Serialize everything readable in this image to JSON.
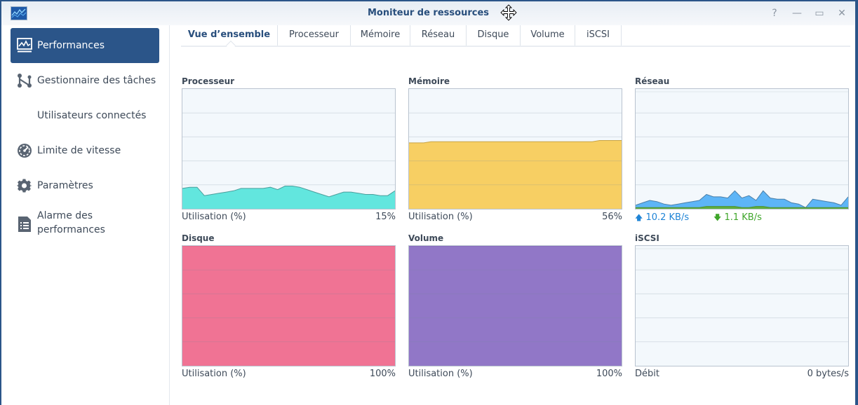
{
  "window": {
    "title": "Moniteur de ressources",
    "controls": [
      {
        "name": "help",
        "glyph": "?"
      },
      {
        "name": "minimize",
        "glyph": "—"
      },
      {
        "name": "maximize",
        "glyph": "▭"
      },
      {
        "name": "close",
        "glyph": "✕"
      }
    ]
  },
  "sidebar": {
    "items": [
      {
        "label": "Performances",
        "icon": "performance-chart-icon",
        "active": true
      },
      {
        "label": "Gestionnaire des tâches",
        "icon": "task-manager-icon",
        "active": false
      },
      {
        "label": "Utilisateurs connectés",
        "icon": "",
        "active": false
      },
      {
        "label": "Limite de vitesse",
        "icon": "speedometer-icon",
        "active": false
      },
      {
        "label": "Paramètres",
        "icon": "gear-icon",
        "active": false
      },
      {
        "label": "Alarme des performances",
        "icon": "document-list-icon",
        "active": false
      }
    ]
  },
  "tabs": [
    {
      "label": "Vue d’ensemble",
      "active": true
    },
    {
      "label": "Processeur",
      "active": false
    },
    {
      "label": "Mémoire",
      "active": false
    },
    {
      "label": "Réseau",
      "active": false
    },
    {
      "label": "Disque",
      "active": false
    },
    {
      "label": "Volume",
      "active": false
    },
    {
      "label": "iSCSI",
      "active": false
    }
  ],
  "colors": {
    "accent": "#2b5589",
    "cpu": "#62e6de",
    "memory": "#f7cf63",
    "network_up": "#5db5f7",
    "network_down": "#5fae3e",
    "disk": "#f07394",
    "volume": "#9177c7"
  },
  "chart_data": [
    {
      "id": "cpu",
      "type": "area",
      "title": "Processeur",
      "footer_label": "Utilisation (%)",
      "footer_value": "15%",
      "ylim": [
        0,
        100
      ],
      "grid": true,
      "series": [
        {
          "name": "cpu",
          "values": [
            17,
            18,
            18,
            11,
            12,
            13,
            14,
            15,
            17,
            17,
            17,
            17,
            18,
            16,
            19,
            19,
            18,
            16,
            14,
            12,
            10,
            12,
            14,
            14,
            13,
            12,
            12,
            11,
            11,
            15
          ]
        }
      ]
    },
    {
      "id": "memory",
      "type": "area",
      "title": "Mémoire",
      "footer_label": "Utilisation (%)",
      "footer_value": "56%",
      "ylim": [
        0,
        100
      ],
      "grid": true,
      "series": [
        {
          "name": "memory",
          "values": [
            55,
            55,
            55,
            56,
            56,
            56,
            56,
            56,
            56,
            56,
            56,
            56,
            56,
            56,
            56,
            56,
            56,
            56,
            56,
            56,
            56,
            56,
            56,
            56,
            56,
            56,
            57,
            57,
            57,
            57
          ]
        }
      ]
    },
    {
      "id": "network",
      "type": "area",
      "title": "Réseau",
      "footer_up": "10.2 KB/s",
      "footer_down": "1.1 KB/s",
      "ylim": [
        0,
        100
      ],
      "grid": true,
      "series": [
        {
          "name": "upload",
          "values": [
            3,
            5,
            7,
            6,
            4,
            3,
            4,
            5,
            6,
            7,
            12,
            10,
            10,
            9,
            15,
            9,
            11,
            7,
            15,
            9,
            8,
            8,
            5,
            4,
            1,
            8,
            7,
            6,
            5,
            3,
            10
          ]
        },
        {
          "name": "download",
          "values": [
            1,
            1,
            1,
            1,
            1,
            1,
            1,
            1,
            1,
            1,
            2,
            2,
            2,
            2,
            2,
            1,
            1,
            2,
            2,
            1,
            1,
            1,
            1,
            1,
            1,
            1,
            1,
            1,
            1,
            1,
            1
          ]
        }
      ]
    },
    {
      "id": "disk",
      "type": "area",
      "title": "Disque",
      "footer_label": "Utilisation (%)",
      "footer_value": "100%",
      "ylim": [
        0,
        100
      ],
      "grid": true,
      "series": [
        {
          "name": "disk",
          "values": [
            100,
            100,
            100,
            100,
            100,
            100,
            100,
            100,
            100,
            100
          ]
        }
      ]
    },
    {
      "id": "volume",
      "type": "area",
      "title": "Volume",
      "footer_label": "Utilisation (%)",
      "footer_value": "100%",
      "ylim": [
        0,
        100
      ],
      "grid": true,
      "series": [
        {
          "name": "volume",
          "values": [
            100,
            100,
            100,
            100,
            100,
            100,
            100,
            100,
            100,
            100
          ]
        }
      ]
    },
    {
      "id": "iscsi",
      "type": "area",
      "title": "iSCSI",
      "footer_label": "Débit",
      "footer_value": "0 bytes/s",
      "ylim": [
        0,
        100
      ],
      "grid": true,
      "series": [
        {
          "name": "iscsi",
          "values": [
            0,
            0,
            0,
            0,
            0,
            0,
            0,
            0,
            0,
            0
          ]
        }
      ]
    }
  ]
}
